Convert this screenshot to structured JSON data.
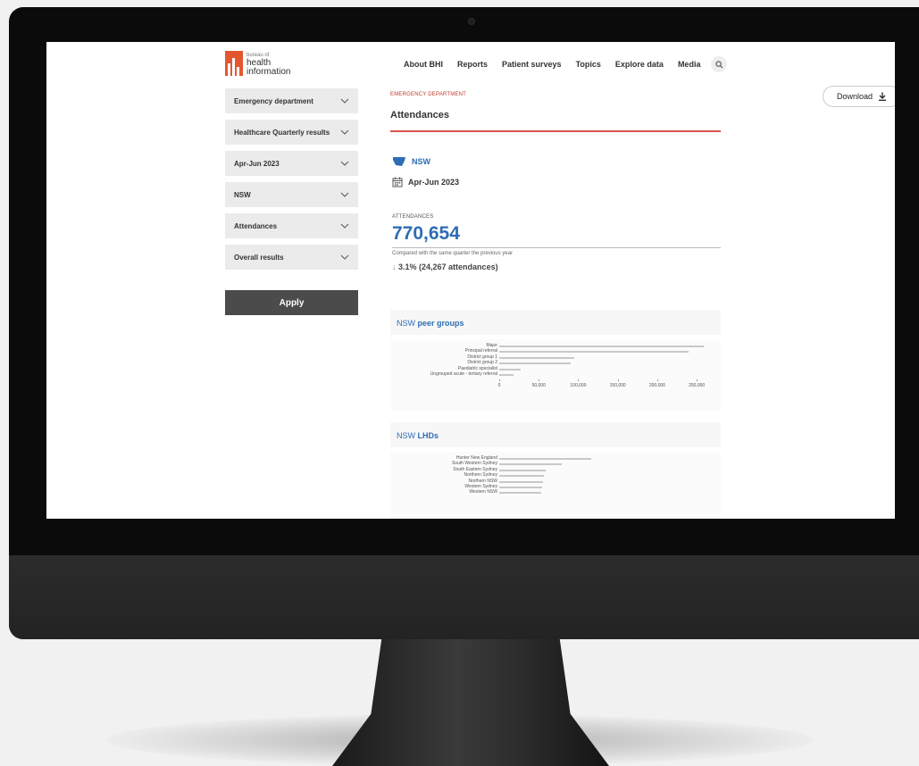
{
  "logo": {
    "line1": "bureau of",
    "line2": "health",
    "line3": "information",
    "color": "#e4572e"
  },
  "nav": {
    "items": [
      "About BHI",
      "Reports",
      "Patient surveys",
      "Topics",
      "Explore data",
      "Media"
    ],
    "search_icon": "search-icon"
  },
  "download": {
    "label": "Download",
    "icon": "download-icon"
  },
  "filters": [
    {
      "label": "Emergency department"
    },
    {
      "label": "Healthcare Quarterly results"
    },
    {
      "label": "Apr-Jun 2023"
    },
    {
      "label": "NSW"
    },
    {
      "label": "Attendances"
    },
    {
      "label": "Overall results"
    }
  ],
  "apply_label": "Apply",
  "main": {
    "breadcrumb": "EMERGENCY DEPARTMENT",
    "title": "Attendances",
    "region": "NSW",
    "period": "Apr-Jun 2023",
    "stat_label": "ATTENDANCES",
    "stat_value": "770,654",
    "compare_text": "Compared with the same quarter the previous year",
    "change_arrow": "↓",
    "change_text": "3.1% (24,267 attendances)",
    "accent": "#2e6db4",
    "red": "#d9534f"
  },
  "peer_card": {
    "prefix": "NSW",
    "suffix": "peer groups"
  },
  "lhd_card": {
    "prefix": "NSW",
    "suffix": "LHDs"
  },
  "chart_data": [
    {
      "type": "bar",
      "orientation": "horizontal",
      "categories": [
        "Major",
        "Principal referral",
        "District group 1",
        "District group 2",
        "Paediatric specialist",
        "Ungrouped acute - tertiary referral"
      ],
      "values": [
        259000,
        240000,
        95000,
        90000,
        27000,
        18000
      ],
      "xlim": [
        0,
        260000
      ],
      "xticks": [
        "0",
        "50,000",
        "100,000",
        "150,000",
        "200,000",
        "250,000"
      ],
      "tick_values": [
        0,
        50000,
        100000,
        150000,
        200000,
        250000
      ]
    },
    {
      "type": "bar",
      "orientation": "horizontal",
      "categories": [
        "Hunter New England",
        "South Western Sydney",
        "South Eastern Sydney",
        "Northern Sydney",
        "Northern NSW",
        "Western Sydney",
        "Western NSW"
      ],
      "values": [
        116000,
        79000,
        59000,
        56000,
        55000,
        54000,
        53000
      ],
      "xlim": [
        0,
        260000
      ]
    }
  ]
}
